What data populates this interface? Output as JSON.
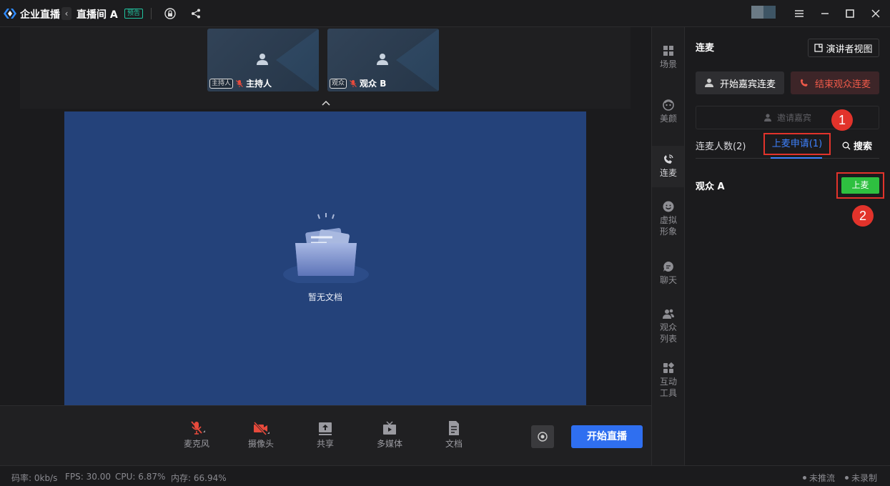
{
  "titlebar": {
    "app_name": "企业直播",
    "room_name": "直播间 A",
    "preview_badge": "预告",
    "collapse_glyph": "‹"
  },
  "thumbnails": [
    {
      "role": "主持人",
      "name": "主持人"
    },
    {
      "role": "观众",
      "name": "观众 B"
    }
  ],
  "stage": {
    "empty_text": "暂无文档"
  },
  "toolbar": {
    "tools": [
      "麦克风",
      "摄像头",
      "共享",
      "多媒体",
      "文档"
    ],
    "start_live": "开始直播"
  },
  "statusbar": {
    "bitrate": "码率: 0kb/s",
    "fps": "FPS: 30.00",
    "cpu": "CPU: 6.87%",
    "memory": "内存: 66.94%",
    "push": "未推流",
    "record": "未录制"
  },
  "sidetabs": [
    "场景",
    "美颜",
    "连麦",
    "虚拟形象",
    "聊天",
    "观众列表",
    "互动工具"
  ],
  "sidetab_lines": {
    "virtual_1": "虚拟",
    "virtual_2": "形象",
    "audience_1": "观众",
    "audience_2": "列表",
    "tools_1": "互动",
    "tools_2": "工具"
  },
  "panel": {
    "title": "连麦",
    "presenter_view": "演讲者视图",
    "guest_connect": "开始嘉宾连麦",
    "end_audience": "结束观众连麦",
    "invite": "邀请嘉宾",
    "tab_count": "连麦人数(2)",
    "tab_apply": "上麦申请(1)",
    "tab_search": "搜索",
    "audience_name": "观众 A",
    "up_button": "上麦",
    "marker_1": "1",
    "marker_2": "2"
  },
  "colors": {
    "accent": "#2f6ff0",
    "tab_active": "#3e82ff",
    "danger": "#f05a4a",
    "annotation": "#e2332b",
    "success": "#2ec040",
    "doc_bg": "#24427a"
  }
}
